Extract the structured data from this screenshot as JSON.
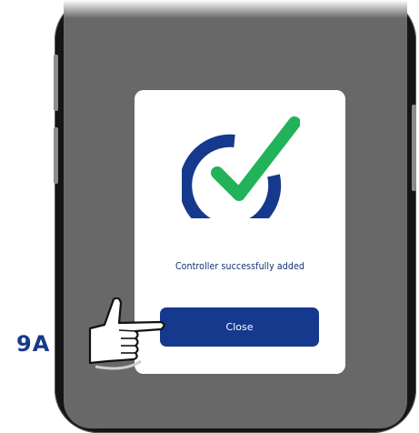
{
  "dialog": {
    "message": "Controller successfully added",
    "close_label": "Close",
    "icon": "checkmark-circle-icon"
  },
  "annotation": {
    "step_label": "9A",
    "pointer_icon": "pointing-hand-icon"
  },
  "colors": {
    "brand_blue": "#15398c",
    "check_green": "#22b25a",
    "overlay": "#686868",
    "dialog_bg": "#ffffff"
  }
}
